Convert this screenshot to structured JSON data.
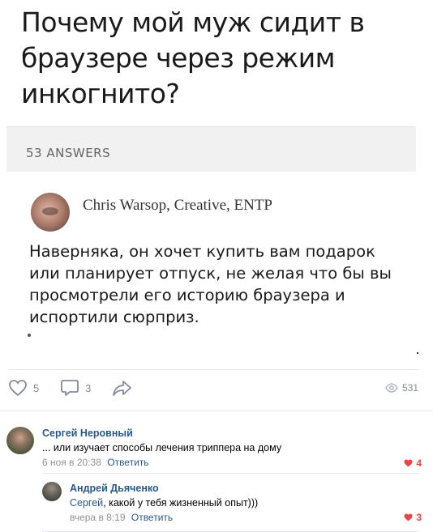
{
  "post": {
    "question": "Почему мой муж сидит в браузере через режим инкогнито?",
    "answers_count": "53 ANSWERS",
    "author": "Chris Warsop, Creative, ENTP",
    "answer": "Наверняка, он хочет купить вам подарок или планирует отпуск, не желая что бы вы просмотрели его историю браузера и испортили сюрприз."
  },
  "actions": {
    "likes": "5",
    "comments": "3",
    "views": "531",
    "icons": [
      "heart-icon",
      "comment-icon",
      "share-icon",
      "eye-icon"
    ]
  },
  "comments": [
    {
      "author": "Сергей Неровный",
      "text": "... или изучает способы лечения триппера на дому",
      "time": "6 ноя в 20:38",
      "reply": "Ответить",
      "likes": "4"
    },
    {
      "author": "Андрей Дьяченко",
      "mention": "Сергей",
      "text": ", какой у тебя жизненный опыт)))",
      "time": "вчера в 8:19",
      "reply": "Ответить",
      "likes": "3"
    }
  ],
  "colors": {
    "link": "#2a5885",
    "meta": "#939393",
    "like": "#e64646",
    "icon": "#828a99"
  }
}
